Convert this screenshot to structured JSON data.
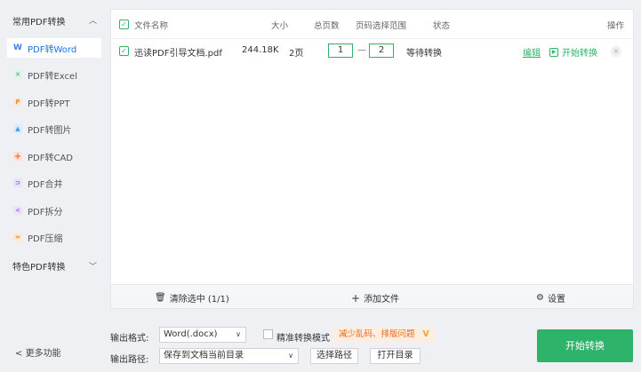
{
  "sidebar": {
    "group1": "常用PDF转换",
    "items": [
      {
        "label": "PDF转Word",
        "icon": "word-icon",
        "color": "#3b7cf5"
      },
      {
        "label": "PDF转Excel",
        "icon": "excel-icon",
        "color": "#2db46a"
      },
      {
        "label": "PDF转PPT",
        "icon": "ppt-icon",
        "color": "#f08a2d"
      },
      {
        "label": "PDF转图片",
        "icon": "image-icon",
        "color": "#3b9cf5"
      },
      {
        "label": "PDF转CAD",
        "icon": "cad-icon",
        "color": "#f06a2d"
      },
      {
        "label": "PDF合并",
        "icon": "merge-icon",
        "color": "#7b5cf5"
      },
      {
        "label": "PDF拆分",
        "icon": "split-icon",
        "color": "#9b5cf5"
      },
      {
        "label": "PDF压缩",
        "icon": "compress-icon",
        "color": "#f08a2d"
      }
    ],
    "group2": "特色PDF转换",
    "more": "更多功能"
  },
  "table": {
    "headers": {
      "name": "文件名称",
      "size": "大小",
      "pages": "总页数",
      "range": "页码选择范围",
      "status": "状态",
      "action": "操作"
    },
    "rows": [
      {
        "name": "迅读PDF引导文档.pdf",
        "size": "244.18K",
        "pages": "2页",
        "from": "1",
        "dash": "—",
        "to": "2",
        "status": "等待转换",
        "edit": "编辑",
        "start": "开始转换"
      }
    ]
  },
  "footer": {
    "clear": "清除选中 (1/1)",
    "add": "添加文件",
    "settings": "设置"
  },
  "output": {
    "format_label": "输出格式:",
    "format_value": "Word(.docx)",
    "precise_label": "精准转换模式",
    "tag": "减少乱码、排版问题",
    "path_label": "输出路径:",
    "path_value": "保存到文档当前目录",
    "choose_path": "选择路径",
    "open_dir": "打开目录",
    "start": "开始转换"
  },
  "colors": {
    "accent": "#2db46a",
    "active_blue": "#1a73e8",
    "tag_orange": "#e86a1e"
  }
}
